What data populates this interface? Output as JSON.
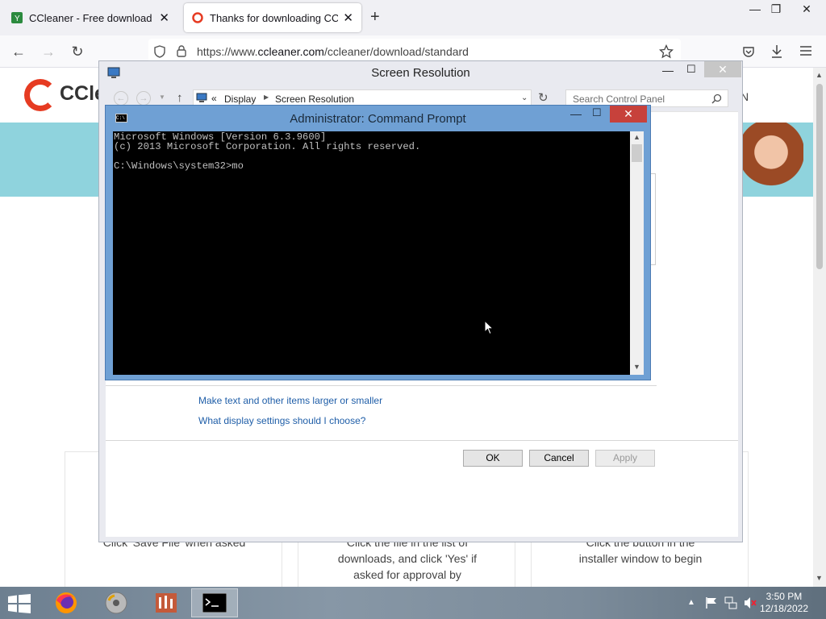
{
  "browser": {
    "tabs": [
      {
        "title": "CCleaner - Free download and",
        "active": false
      },
      {
        "title": "Thanks for downloading CClea",
        "active": true
      }
    ],
    "url_domain": "ccleaner.com",
    "url_prefix": "https://www.",
    "url_path": "/ccleaner/download/standard"
  },
  "web_page": {
    "logo_text": "CClea",
    "nav_letter": "N",
    "card2_text": "Click the file in the list of downloads, and click 'Yes' if asked for approval by",
    "card3_text": "Click the button in the installer window to begin",
    "card1_text": "Click 'Save File' when asked"
  },
  "screen_resolution": {
    "title": "Screen Resolution",
    "breadcrumb": [
      "Display",
      "Screen Resolution"
    ],
    "breadcrumb_prefix": "«",
    "search_placeholder": "Search Control Panel",
    "links": [
      "Make text and other items larger or smaller",
      "What display settings should I choose?"
    ],
    "buttons": {
      "ok": "OK",
      "cancel": "Cancel",
      "apply": "Apply"
    }
  },
  "cmd": {
    "title": "Administrator: Command Prompt",
    "icon_text": "C:\\",
    "lines": "Microsoft Windows [Version 6.3.9600]\n(c) 2013 Microsoft Corporation. All rights reserved.\n\nC:\\Windows\\system32>mo"
  },
  "taskbar": {
    "time": "3:50 PM",
    "date": "12/18/2022",
    "apps": [
      "firefox-icon",
      "dvd-icon",
      "control-panel-icon",
      "cmd-icon"
    ]
  },
  "colors": {
    "ccleaner_red": "#e63b22",
    "cmd_frame": "#6fa0d4",
    "link_blue": "#1f5ea8"
  }
}
